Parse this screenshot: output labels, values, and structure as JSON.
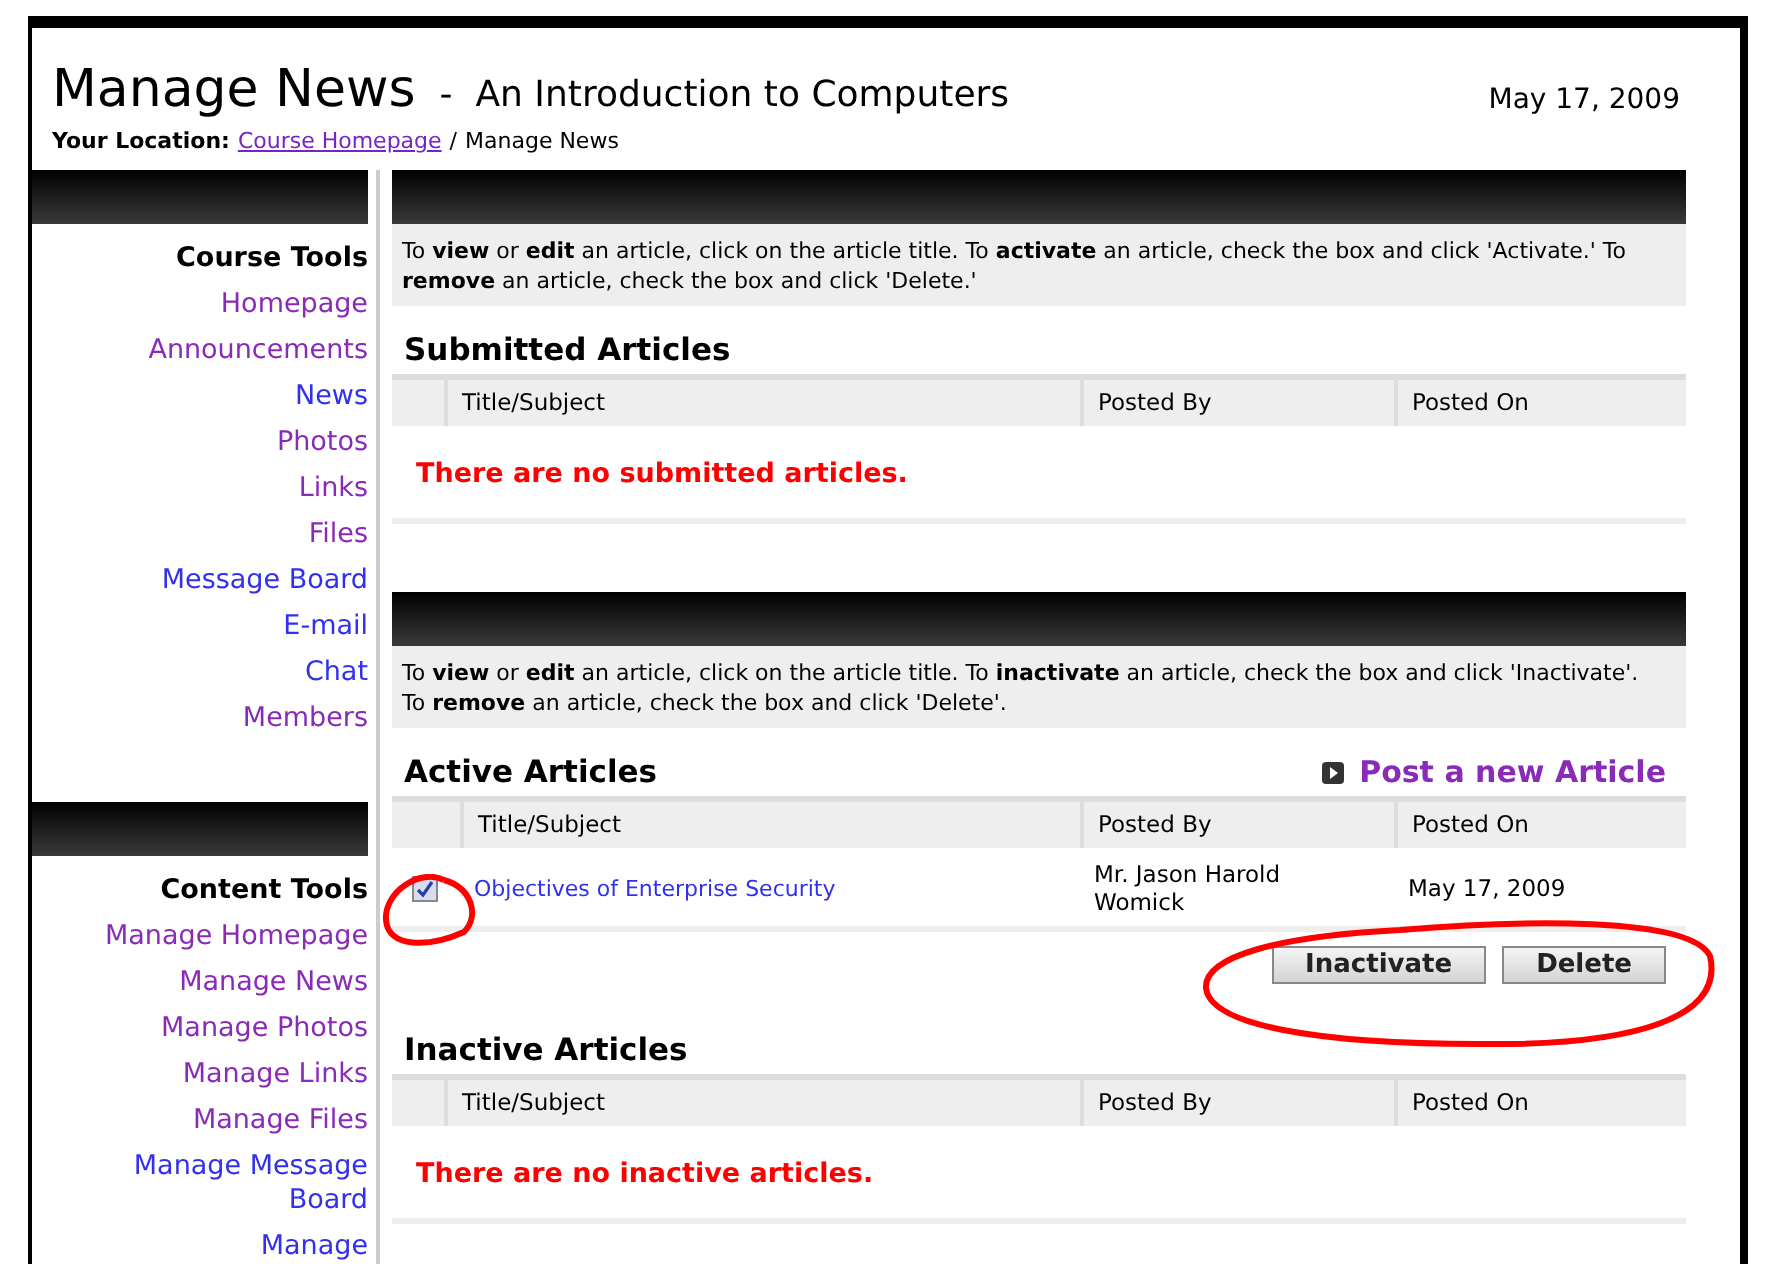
{
  "page": {
    "title": "Manage News",
    "subtitle": "-  An Introduction to Computers",
    "date": "May 17, 2009"
  },
  "location": {
    "label": "Your Location:",
    "link": "Course Homepage",
    "separator": "/",
    "current": "Manage News"
  },
  "sidebar": [
    {
      "heading": "Course Tools",
      "items": [
        {
          "label": "Homepage",
          "visited": true
        },
        {
          "label": "Announcements",
          "visited": true
        },
        {
          "label": "News",
          "visited": false
        },
        {
          "label": "Photos",
          "visited": true
        },
        {
          "label": "Links",
          "visited": true
        },
        {
          "label": "Files",
          "visited": true
        },
        {
          "label": "Message Board",
          "visited": false
        },
        {
          "label": "E-mail",
          "visited": false
        },
        {
          "label": "Chat",
          "visited": false
        },
        {
          "label": "Members",
          "visited": true
        }
      ]
    },
    {
      "heading": "Content Tools",
      "items": [
        {
          "label": "Manage Homepage",
          "visited": true
        },
        {
          "label": "Manage News",
          "visited": true
        },
        {
          "label": "Manage Photos",
          "visited": true
        },
        {
          "label": "Manage Links",
          "visited": true
        },
        {
          "label": "Manage Files",
          "visited": true
        },
        {
          "label": "Manage Message Board",
          "visited": false
        },
        {
          "label": "Manage",
          "visited": false
        }
      ]
    }
  ],
  "sections": [
    {
      "instructions": "To **view** or **edit** an article, click on the article title. To **activate** an article, check the box and click 'Activate.' To **remove** an article, check the box and click 'Delete.'",
      "title": "Submitted Articles",
      "columns": [
        "Title/Subject",
        "Posted By",
        "Posted On"
      ],
      "empty_message": "There are no submitted articles."
    },
    {
      "instructions": "To **view** or **edit** an article, click on the article title. To **inactivate** an article, check the box and click 'Inactivate'. To **remove** an article, check the box and click 'Delete'.",
      "title": "Active Articles",
      "post_link": "Post a new Article",
      "columns": [
        "Title/Subject",
        "Posted By",
        "Posted On"
      ],
      "rows": [
        {
          "checked": true,
          "title": "Objectives of Enterprise Security",
          "posted_by": "Mr. Jason Harold Womick",
          "posted_on": "May 17, 2009"
        }
      ],
      "buttons": [
        "Inactivate",
        "Delete"
      ]
    },
    {
      "title": "Inactive Articles",
      "columns": [
        "Title/Subject",
        "Posted By",
        "Posted On"
      ],
      "empty_message": "There are no inactive articles."
    }
  ]
}
